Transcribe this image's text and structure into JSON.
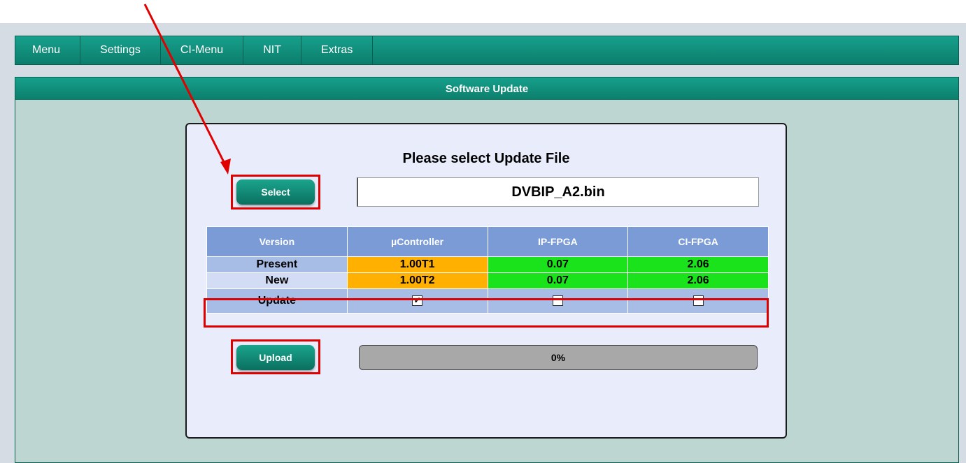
{
  "nav": {
    "items": [
      {
        "label": "Menu"
      },
      {
        "label": "Settings"
      },
      {
        "label": "CI-Menu"
      },
      {
        "label": "NIT"
      },
      {
        "label": "Extras"
      }
    ]
  },
  "panel": {
    "title": "Software Update"
  },
  "update": {
    "prompt": "Please select Update File",
    "select_label": "Select",
    "file_name": "DVBIP_A2.bin",
    "upload_label": "Upload",
    "progress_text": "0%",
    "progress_value": 0
  },
  "versions": {
    "headers": [
      "Version",
      "µController",
      "IP-FPGA",
      "CI-FPGA"
    ],
    "present": {
      "label": "Present",
      "values": [
        "1.00T1",
        "0.07",
        "2.06"
      ]
    },
    "new": {
      "label": "New",
      "values": [
        "1.00T2",
        "0.07",
        "2.06"
      ]
    },
    "update": {
      "label": "Update",
      "checked": [
        true,
        false,
        false
      ]
    }
  },
  "colors": {
    "nav_bg": "#0c7e6c",
    "panel_bg": "#bdd6d2",
    "header_blue": "#7a9bd6",
    "orange": "#ffb000",
    "green": "#1be31b",
    "highlight_red": "#e00000"
  }
}
